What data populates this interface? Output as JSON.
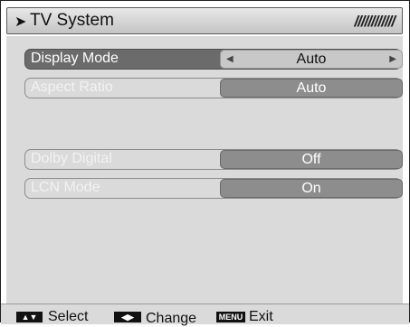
{
  "header": {
    "title": "TV System",
    "decoration": "////////////"
  },
  "menu": {
    "items": [
      {
        "label": "Display Mode",
        "value": "Auto"
      },
      {
        "label": "Aspect Ratio",
        "value": "Auto"
      },
      {
        "label": "Dolby Digital",
        "value": "Off"
      },
      {
        "label": "LCN Mode",
        "value": "On"
      }
    ]
  },
  "footer": {
    "select_label": "Select",
    "change_label": "Change",
    "menu_key": "MENU",
    "exit_label": "Exit"
  }
}
